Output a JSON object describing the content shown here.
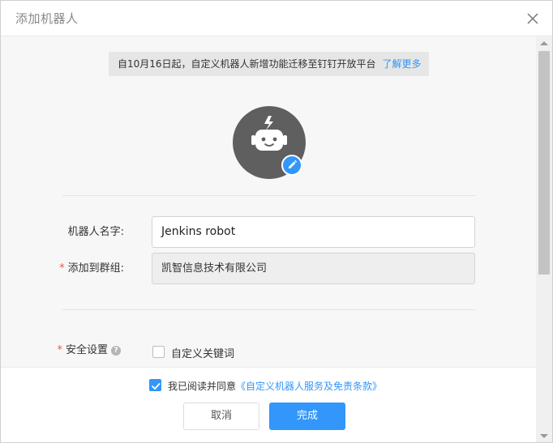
{
  "dialog": {
    "title": "添加机器人",
    "close_icon": "close-icon"
  },
  "notice": {
    "text": "自10月16日起，自定义机器人新增功能迁移至钉钉开放平台",
    "link": "了解更多"
  },
  "avatar": {
    "icon": "robot-icon",
    "edit_icon": "pencil-icon",
    "color": "#5f5f5f",
    "badge_color": "#3296fa"
  },
  "form": {
    "name_label": "机器人名字:",
    "name_value": "Jenkins robot",
    "group_label": "添加到群组:",
    "group_value": "凯智信息技术有限公司",
    "security_label": "安全设置",
    "keyword_option": "自定义关键词",
    "required_mark": "*"
  },
  "footer": {
    "agree_text": "我已阅读并同意",
    "agree_link": "《自定义机器人服务及免责条款》",
    "agree_checked": true,
    "cancel_label": "取消",
    "done_label": "完成"
  },
  "colors": {
    "accent": "#3296fa",
    "required": "#f25643"
  }
}
